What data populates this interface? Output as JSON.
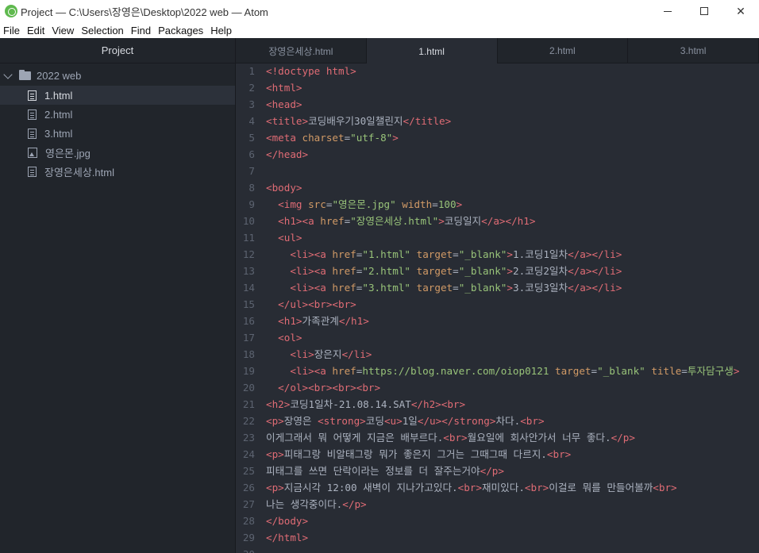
{
  "window": {
    "title": "Project — C:\\Users\\장영은\\Desktop\\2022 web — Atom",
    "controls": [
      "minimize",
      "maximize",
      "close"
    ]
  },
  "menu": [
    "File",
    "Edit",
    "View",
    "Selection",
    "Find",
    "Packages",
    "Help"
  ],
  "tree": {
    "header": "Project",
    "root": "2022 web",
    "files": [
      {
        "name": "1.html",
        "type": "file",
        "selected": true
      },
      {
        "name": "2.html",
        "type": "file",
        "selected": false
      },
      {
        "name": "3.html",
        "type": "file",
        "selected": false
      },
      {
        "name": "영은몬.jpg",
        "type": "image",
        "selected": false
      },
      {
        "name": "장영은세상.html",
        "type": "file",
        "selected": false
      }
    ]
  },
  "tabs": [
    {
      "label": "장영은세상.html",
      "active": false
    },
    {
      "label": "1.html",
      "active": true
    },
    {
      "label": "2.html",
      "active": false
    },
    {
      "label": "3.html",
      "active": false
    }
  ],
  "editor": {
    "lines": [
      [
        [
          "t",
          "<!doctype html>"
        ]
      ],
      [
        [
          "t",
          "<html>"
        ]
      ],
      [
        [
          "t",
          "<head>"
        ]
      ],
      [
        [
          "t",
          "<title>"
        ],
        [
          "p",
          "코딩배우기30일챌린지"
        ],
        [
          "t",
          "</title>"
        ]
      ],
      [
        [
          "t",
          "<meta "
        ],
        [
          "a",
          "charset"
        ],
        [
          "p",
          "="
        ],
        [
          "s",
          "\"utf-8\""
        ],
        [
          "t",
          ">"
        ]
      ],
      [
        [
          "t",
          "</head>"
        ]
      ],
      [],
      [
        [
          "t",
          "<body>"
        ]
      ],
      [
        [
          "p",
          "  "
        ],
        [
          "t",
          "<img "
        ],
        [
          "a",
          "src"
        ],
        [
          "p",
          "="
        ],
        [
          "s",
          "\"영은몬.jpg\""
        ],
        [
          "p",
          " "
        ],
        [
          "a",
          "width"
        ],
        [
          "p",
          "="
        ],
        [
          "s",
          "100"
        ],
        [
          "t",
          ">"
        ]
      ],
      [
        [
          "p",
          "  "
        ],
        [
          "t",
          "<h1><a "
        ],
        [
          "a",
          "href"
        ],
        [
          "p",
          "="
        ],
        [
          "s",
          "\"장영은세상.html\""
        ],
        [
          "t",
          ">"
        ],
        [
          "p",
          "코딩일지"
        ],
        [
          "t",
          "</a></h1>"
        ]
      ],
      [
        [
          "p",
          "  "
        ],
        [
          "t",
          "<ul>"
        ]
      ],
      [
        [
          "p",
          "    "
        ],
        [
          "t",
          "<li><a "
        ],
        [
          "a",
          "href"
        ],
        [
          "p",
          "="
        ],
        [
          "s",
          "\"1.html\""
        ],
        [
          "p",
          " "
        ],
        [
          "a",
          "target"
        ],
        [
          "p",
          "="
        ],
        [
          "s",
          "\"_blank\""
        ],
        [
          "t",
          ">"
        ],
        [
          "p",
          "1.코딩1일차"
        ],
        [
          "t",
          "</a></li>"
        ]
      ],
      [
        [
          "p",
          "    "
        ],
        [
          "t",
          "<li><a "
        ],
        [
          "a",
          "href"
        ],
        [
          "p",
          "="
        ],
        [
          "s",
          "\"2.html\""
        ],
        [
          "p",
          " "
        ],
        [
          "a",
          "target"
        ],
        [
          "p",
          "="
        ],
        [
          "s",
          "\"_blank\""
        ],
        [
          "t",
          ">"
        ],
        [
          "p",
          "2.코딩2일차"
        ],
        [
          "t",
          "</a></li>"
        ]
      ],
      [
        [
          "p",
          "    "
        ],
        [
          "t",
          "<li><a "
        ],
        [
          "a",
          "href"
        ],
        [
          "p",
          "="
        ],
        [
          "s",
          "\"3.html\""
        ],
        [
          "p",
          " "
        ],
        [
          "a",
          "target"
        ],
        [
          "p",
          "="
        ],
        [
          "s",
          "\"_blank\""
        ],
        [
          "t",
          ">"
        ],
        [
          "p",
          "3.코딩3일차"
        ],
        [
          "t",
          "</a></li>"
        ]
      ],
      [
        [
          "p",
          "  "
        ],
        [
          "t",
          "</ul><br><br>"
        ]
      ],
      [
        [
          "p",
          "  "
        ],
        [
          "t",
          "<h1>"
        ],
        [
          "p",
          "가족관계"
        ],
        [
          "t",
          "</h1>"
        ]
      ],
      [
        [
          "p",
          "  "
        ],
        [
          "t",
          "<ol>"
        ]
      ],
      [
        [
          "p",
          "    "
        ],
        [
          "t",
          "<li>"
        ],
        [
          "p",
          "장은지"
        ],
        [
          "t",
          "</li>"
        ]
      ],
      [
        [
          "p",
          "    "
        ],
        [
          "t",
          "<li><a "
        ],
        [
          "a",
          "href"
        ],
        [
          "p",
          "="
        ],
        [
          "s",
          "https://blog.naver.com/oiop0121"
        ],
        [
          "p",
          " "
        ],
        [
          "a",
          "target"
        ],
        [
          "p",
          "="
        ],
        [
          "s",
          "\"_blank\""
        ],
        [
          "p",
          " "
        ],
        [
          "a",
          "title"
        ],
        [
          "p",
          "="
        ],
        [
          "s",
          "투자담구생"
        ],
        [
          "t",
          ">"
        ]
      ],
      [
        [
          "p",
          "  "
        ],
        [
          "t",
          "</ol><br><br><br>"
        ]
      ],
      [
        [
          "t",
          "<h2>"
        ],
        [
          "p",
          "코딩1일차-21.08.14.SAT"
        ],
        [
          "t",
          "</h2><br>"
        ]
      ],
      [
        [
          "t",
          "<p>"
        ],
        [
          "p",
          "장영은 "
        ],
        [
          "t",
          "<strong>"
        ],
        [
          "p",
          "코딩"
        ],
        [
          "t",
          "<u>"
        ],
        [
          "p",
          "1일"
        ],
        [
          "t",
          "</u></strong>"
        ],
        [
          "p",
          "차다."
        ],
        [
          "t",
          "<br>"
        ]
      ],
      [
        [
          "p",
          "이게그래서 뭐 어떻게 지금은 배부르다."
        ],
        [
          "t",
          "<br>"
        ],
        [
          "p",
          "월요일에 회사안가서 너무 좋다."
        ],
        [
          "t",
          "</p>"
        ]
      ],
      [
        [
          "t",
          "<p>"
        ],
        [
          "p",
          "피태그랑 비알태그랑 뭐가 좋은지 그거는 그때그때 다르지."
        ],
        [
          "t",
          "<br>"
        ]
      ],
      [
        [
          "p",
          "피태그를 쓰면 단락이라는 정보를 더 잘주는거야"
        ],
        [
          "t",
          "</p>"
        ]
      ],
      [
        [
          "t",
          "<p>"
        ],
        [
          "p",
          "지금시각 12:00 새벽이 지나가고있다."
        ],
        [
          "t",
          "<br>"
        ],
        [
          "p",
          "재미있다."
        ],
        [
          "t",
          "<br>"
        ],
        [
          "p",
          "이걸로 뭐를 만들어볼까"
        ],
        [
          "t",
          "<br>"
        ]
      ],
      [
        [
          "p",
          "나는 생각중이다."
        ],
        [
          "t",
          "</p>"
        ]
      ],
      [
        [
          "t",
          "</body>"
        ]
      ],
      [
        [
          "t",
          "</html>"
        ]
      ],
      []
    ]
  }
}
